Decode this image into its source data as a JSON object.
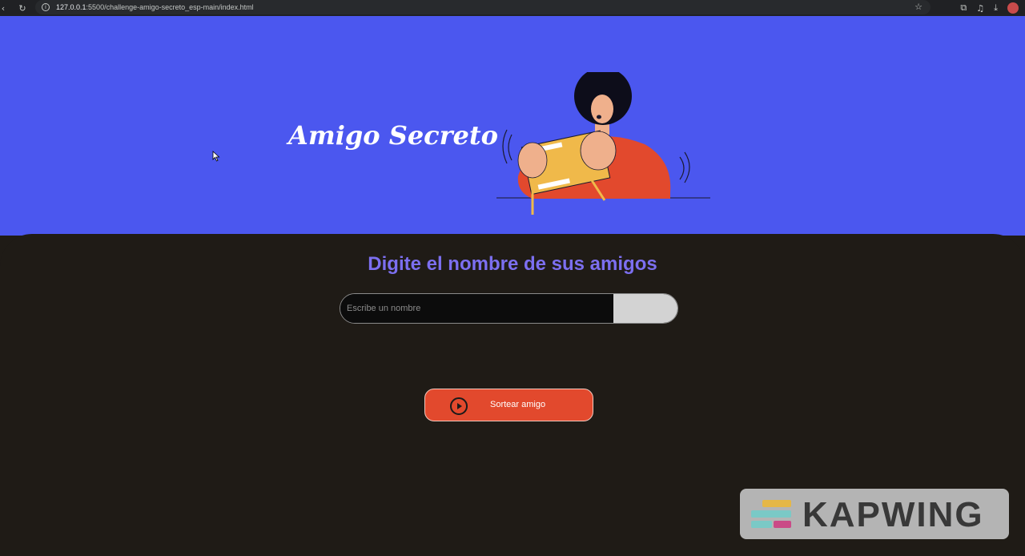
{
  "browser": {
    "url_host": "127.0.0.1",
    "url_path": ":5500/challenge-amigo-secreto_esp-main/index.html"
  },
  "header": {
    "title": "Amigo Secreto"
  },
  "main": {
    "subtitle": "Digite el nombre de sus amigos",
    "input_placeholder": "Escribe un nombre",
    "input_value": "",
    "add_button_label": "",
    "draw_button_label": "Sortear amigo"
  },
  "watermark": {
    "text": "KAPWING"
  },
  "colors": {
    "header_bg": "#4b57ef",
    "main_bg": "#1f1b16",
    "subtitle": "#7c6ff0",
    "draw_button": "#e2492d"
  },
  "icons": [
    "back-icon",
    "reload-icon",
    "info-icon",
    "star-icon",
    "extensions-icon",
    "media-icon",
    "download-icon",
    "play-circle-icon",
    "cursor-icon",
    "kapwing-logo-icon"
  ]
}
